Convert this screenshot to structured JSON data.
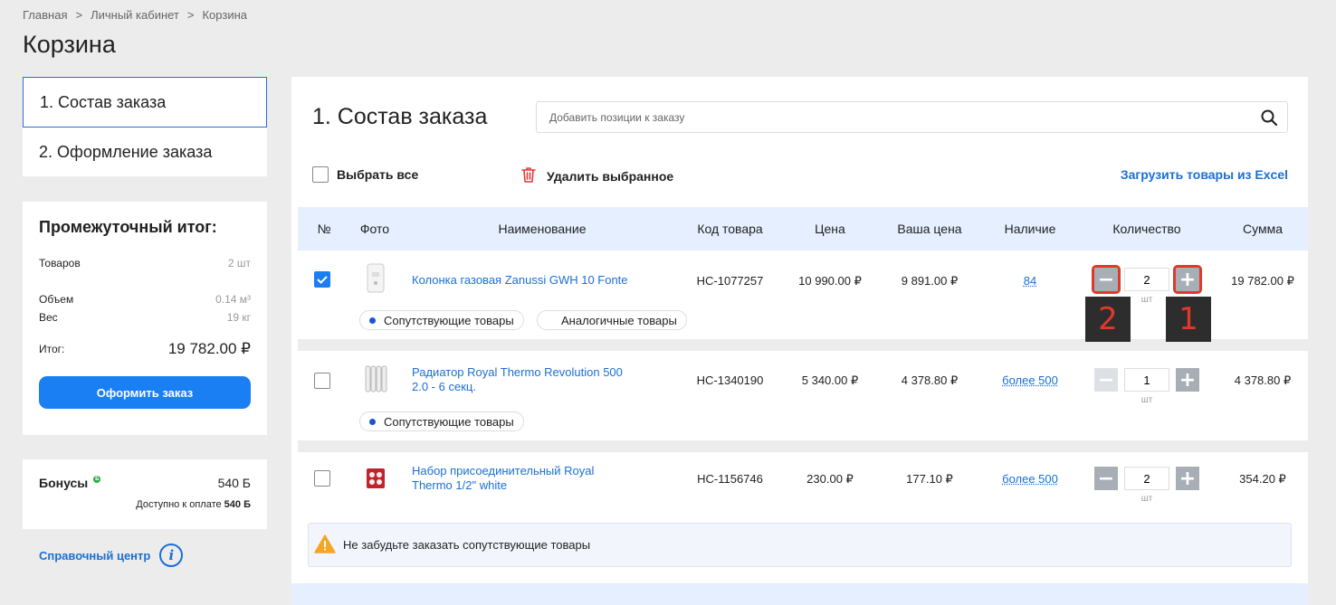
{
  "breadcrumb": {
    "items": [
      "Главная",
      "Личный кабинет",
      "Корзина"
    ],
    "separator": ">"
  },
  "page_title": "Корзина",
  "steps": [
    {
      "label": "1. Состав заказа",
      "active": true
    },
    {
      "label": "2. Оформление заказа",
      "active": false
    }
  ],
  "summary": {
    "title": "Промежуточный итог:",
    "items_label": "Товаров",
    "items_value": "2 шт",
    "volume_label": "Объем",
    "volume_value": "0.14 м³",
    "weight_label": "Вес",
    "weight_value": "19 кг",
    "total_label": "Итог:",
    "total_value": "19 782.00 ₽",
    "order_button": "Оформить заказ"
  },
  "bonus": {
    "label": "Бонусы",
    "badge": "Б",
    "value": "540 Б",
    "available_label": "Доступно к оплате",
    "available_value": "540 Б"
  },
  "help": {
    "label": "Справочный центр"
  },
  "main": {
    "title": "1. Состав заказа",
    "search_placeholder": "Добавить позиции к заказу",
    "select_all": "Выбрать все",
    "delete_selected": "Удалить выбранное",
    "excel_upload": "Загрузить товары из Excel"
  },
  "table": {
    "headers": [
      "№",
      "Фото",
      "Наименование",
      "Код товара",
      "Цена",
      "Ваша цена",
      "Наличие",
      "Количество",
      "Сумма"
    ],
    "rows": [
      {
        "checked": true,
        "name": "Колонка газовая Zanussi GWH 10 Fonte",
        "code": "НС-1077257",
        "price": "10 990.00 ₽",
        "your_price": "9 891.00 ₽",
        "availability": "84",
        "qty": "2",
        "unit": "шт",
        "sum": "19 782.00 ₽",
        "tags": [
          "Сопутствующие товары",
          "Аналогичные товары"
        ]
      },
      {
        "checked": false,
        "name": "Радиатор Royal Thermo Revolution 500 2.0 - 6 секц.",
        "code": "НС-1340190",
        "price": "5 340.00 ₽",
        "your_price": "4 378.80 ₽",
        "availability": "более 500",
        "qty": "1",
        "unit": "шт",
        "sum": "4 378.80 ₽",
        "tags": [
          "Сопутствующие товары"
        ]
      },
      {
        "checked": false,
        "name": "Набор присоединительный Royal Thermo 1/2\" white",
        "code": "НС-1156746",
        "price": "230.00 ₽",
        "your_price": "177.10 ₽",
        "availability": "более 500",
        "qty": "2",
        "unit": "шт",
        "sum": "354.20 ₽",
        "tags": []
      }
    ]
  },
  "callouts": [
    "2",
    "1"
  ],
  "notice": "Не забудьте заказать сопутствующие товары"
}
